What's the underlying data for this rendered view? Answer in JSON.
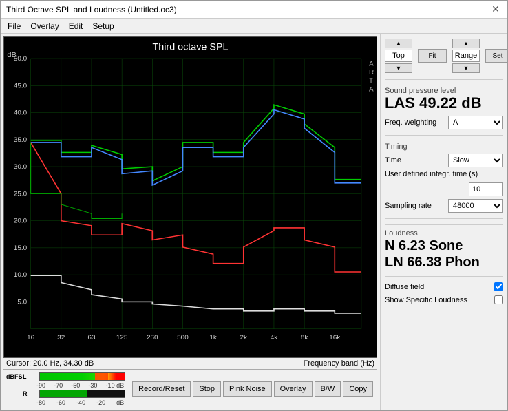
{
  "window": {
    "title": "Third Octave SPL and Loudness (Untitled.oc3)",
    "close_label": "✕"
  },
  "menu": {
    "items": [
      "File",
      "Overlay",
      "Edit",
      "Setup"
    ]
  },
  "chart": {
    "title": "Third octave SPL",
    "db_label": "dB",
    "arta_label": "A\nR\nT\nA",
    "y_labels": [
      "50.0",
      "45.0",
      "40.0",
      "35.0",
      "30.0",
      "25.0",
      "20.0",
      "15.0",
      "10.0",
      "5.0"
    ],
    "x_labels": [
      "16",
      "32",
      "63",
      "125",
      "250",
      "500",
      "1k",
      "2k",
      "4k",
      "8k",
      "16k"
    ],
    "cursor_info": "Cursor:  20.0 Hz, 34.30 dB",
    "freq_band_label": "Frequency band (Hz)"
  },
  "right_panel": {
    "top_label": "Top",
    "range_label": "Range",
    "fit_label": "Fit",
    "set_label": "Set",
    "spl_section_label": "Sound pressure level",
    "spl_value": "LAS 49.22 dB",
    "freq_weighting_label": "Freq. weighting",
    "freq_weighting_value": "A",
    "timing_label": "Timing",
    "time_label": "Time",
    "time_value": "Slow",
    "integr_label": "User defined integr. time (s)",
    "integr_value": "10",
    "sampling_label": "Sampling rate",
    "sampling_value": "48000",
    "loudness_label": "Loudness",
    "loudness_n": "N 6.23 Sone",
    "loudness_ln": "LN 66.38 Phon",
    "diffuse_label": "Diffuse field",
    "show_specific_label": "Show Specific Loudness"
  },
  "bottom_buttons": {
    "record_reset": "Record/Reset",
    "stop": "Stop",
    "pink_noise": "Pink Noise",
    "overlay": "Overlay",
    "bw": "B/W",
    "copy": "Copy"
  },
  "level_meter": {
    "dBFS_label": "dBFS",
    "L_label": "L",
    "R_label": "R",
    "ticks_top": [
      "-90",
      "-70",
      "-50",
      "-30",
      "-10 dB"
    ],
    "ticks_bottom": [
      "-80",
      "-60",
      "-40",
      "-20",
      "dB"
    ]
  }
}
